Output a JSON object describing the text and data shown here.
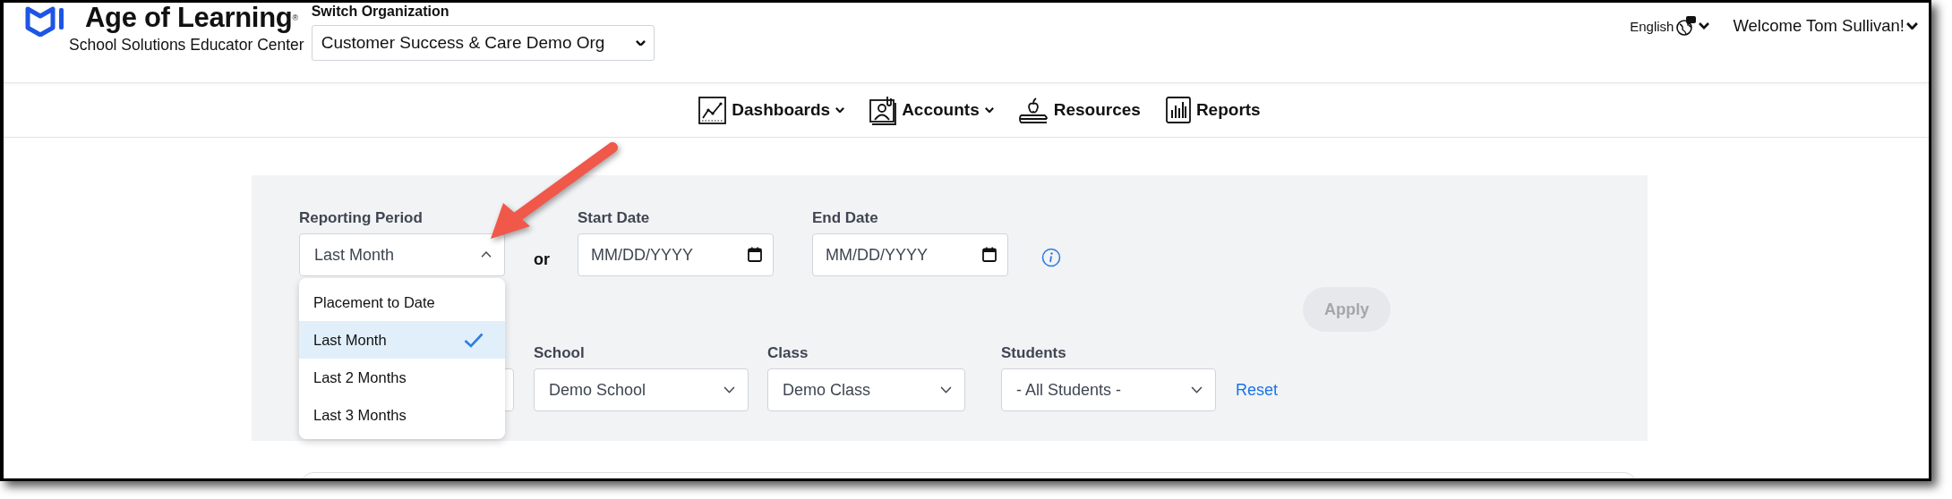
{
  "header": {
    "logo_title": "Age of Learning$^{®}$",
    "logo_subtitle": "School Solutions Educator Center",
    "org_label": "Switch Organization",
    "org_value": "Customer Success & Care Demo Org",
    "language": "English",
    "welcome": "Welcome Tom Sullivan!"
  },
  "nav": [
    {
      "label": "Dashboards",
      "has_menu": true
    },
    {
      "label": "Accounts",
      "has_menu": true
    },
    {
      "label": "Resources",
      "has_menu": false
    },
    {
      "label": "Reports",
      "has_menu": false
    }
  ],
  "reporting_period": {
    "label": "Reporting Period",
    "value": "Last Month",
    "expanded": true,
    "options": [
      {
        "label": "Placement to Date",
        "selected": false
      },
      {
        "label": "Last Month",
        "selected": true
      },
      {
        "label": "Last 2 Months",
        "selected": false
      },
      {
        "label": "Last 3 Months",
        "selected": false
      }
    ]
  },
  "or_text": "or",
  "start_date": {
    "label": "Start Date",
    "placeholder": "MM/DD/YYYY"
  },
  "end_date": {
    "label": "End Date",
    "placeholder": "MM/DD/YYYY"
  },
  "apply_button": {
    "label": "Apply",
    "disabled": true
  },
  "filters": [
    {
      "label": "School",
      "value": "Demo School"
    },
    {
      "label": "Class",
      "value": "Demo Class"
    },
    {
      "label": "Students",
      "value": "- All Students -"
    }
  ],
  "reset_link": "Reset"
}
